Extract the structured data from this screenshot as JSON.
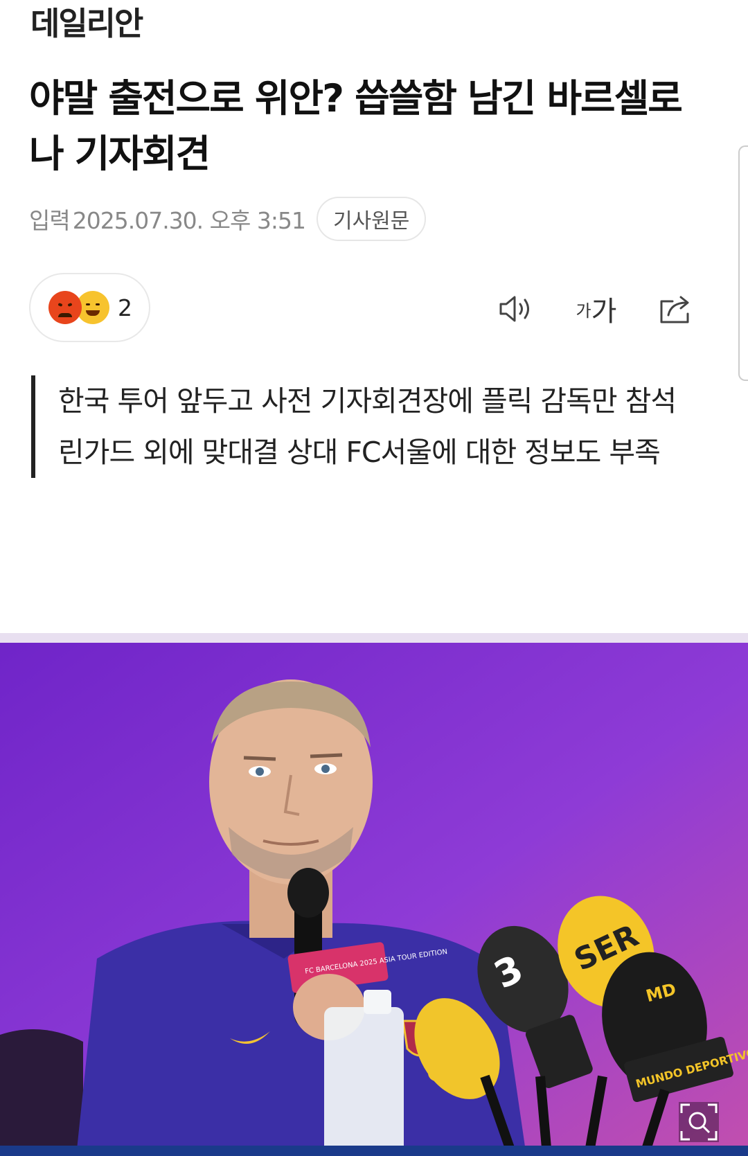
{
  "publisher": {
    "name": "데일리안"
  },
  "article": {
    "headline": "야말 출전으로 위안? 씁쓸함 남긴 바르셀로나 기자회견",
    "meta": {
      "label": "입력",
      "date": "2025.07.30. 오후 3:51",
      "original_button": "기사원문"
    },
    "reactions": {
      "count": "2",
      "emojis": [
        "angry-emoji-icon",
        "laughing-emoji-icon"
      ]
    },
    "summary": [
      "한국 투어 앞두고 사전 기자회견장에 플릭 감독만 참석",
      "린가드 외에 맞대결 상대 FC서울에 대한 정보도 부족"
    ],
    "toolbar": {
      "font_small": "가",
      "font_large": "가"
    },
    "photo": {
      "card_text": "FC BARCELONA 2025 ASIA TOUR EDITION",
      "mic_labels": [
        "3",
        "SER",
        "MD",
        "MUNDO DEPORTIVO"
      ]
    }
  },
  "colors": {
    "photo_bg": "#7a2bd0",
    "angry": "#e8451c",
    "laugh": "#f7c32e",
    "summary_bar": "#222222"
  }
}
